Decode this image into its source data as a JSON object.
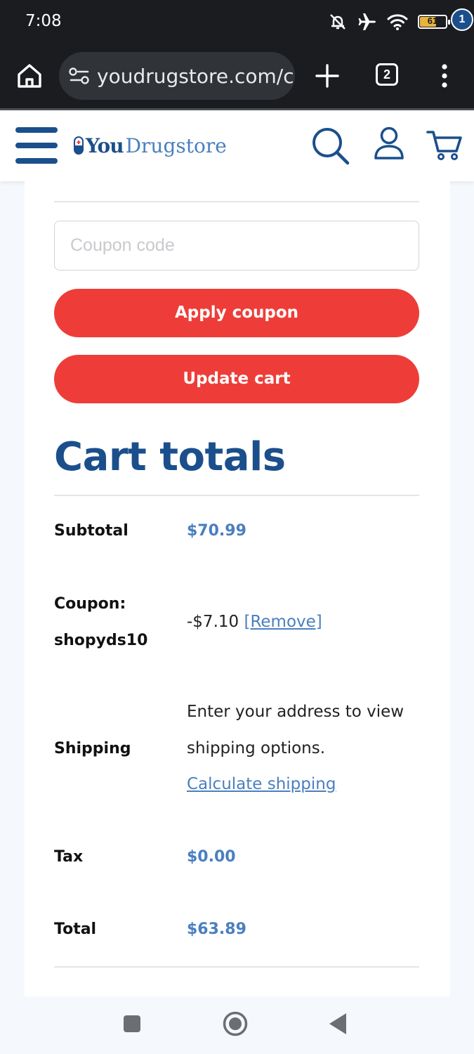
{
  "status_bar": {
    "time": "7:08",
    "battery": "61"
  },
  "browser": {
    "url": "youdrugstore.com/cart",
    "tab_count": "2"
  },
  "header": {
    "logo_you": "You",
    "logo_drugstore": "Drugstore",
    "cart_count": "1"
  },
  "coupon": {
    "placeholder": "Coupon code",
    "apply_label": "Apply coupon",
    "update_label": "Update cart"
  },
  "cart_totals": {
    "title": "Cart totals",
    "subtotal_label": "Subtotal",
    "subtotal_value": "$70.99",
    "coupon_label_line1": "Coupon:",
    "coupon_label_line2": "shopyds10",
    "coupon_value": "-$7.10",
    "coupon_remove": "[Remove]",
    "shipping_label": "Shipping",
    "shipping_line1": "Enter your address to view",
    "shipping_line2": "shipping options.",
    "shipping_link": "Calculate shipping",
    "tax_label": "Tax",
    "tax_value": "$0.00",
    "total_label": "Total",
    "total_value": "$63.89"
  },
  "colors": {
    "brand_blue": "#1b4f8c",
    "link_blue": "#4a7fbf",
    "button_red": "#ee3d38"
  }
}
